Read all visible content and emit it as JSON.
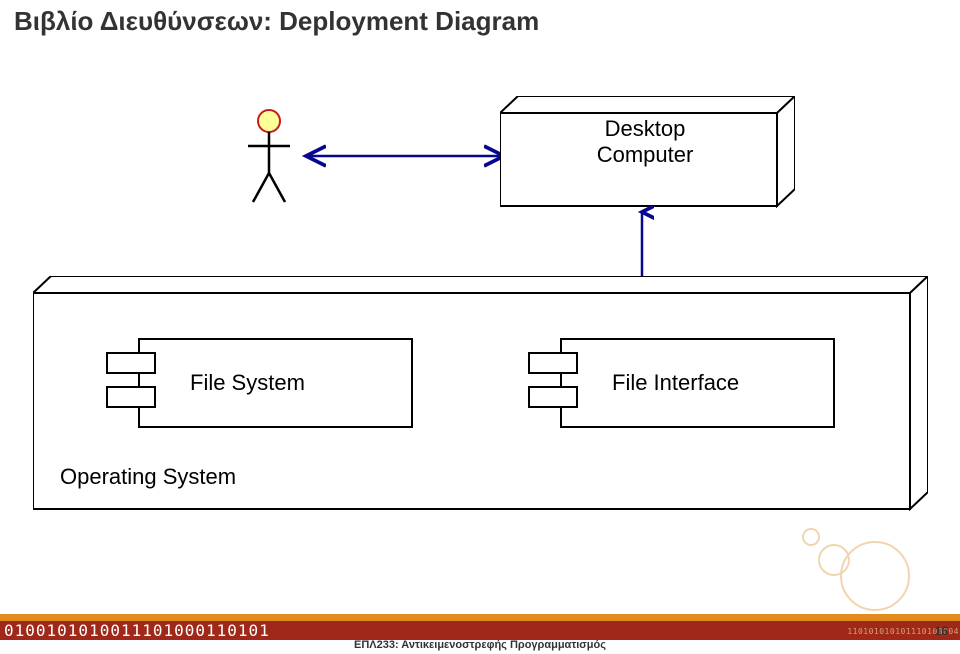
{
  "title": "Βιβλίο Διευθύνσεων: Deployment Diagram",
  "nodes": {
    "desktop": {
      "line1": "Desktop",
      "line2": "Computer"
    },
    "os": {
      "label": "Operating System"
    },
    "file_system": {
      "label": "File System"
    },
    "file_interface": {
      "label": "File Interface"
    }
  },
  "footer": {
    "binary_left": "0100101010011101000110101",
    "binary_right": "110101010101110100004",
    "course": "ΕΠΛ233: Αντικειμενοστρεφής Προγραμματισμός",
    "page_number": "16"
  }
}
